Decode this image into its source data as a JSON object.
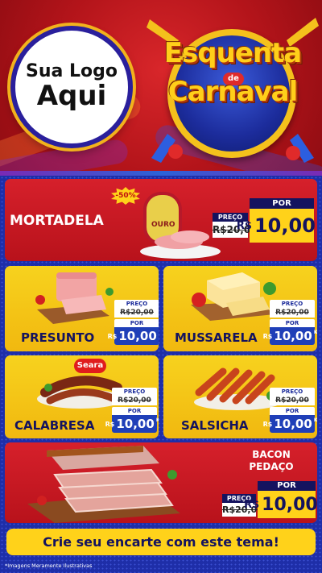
{
  "header": {
    "logo_line1": "Sua Logo",
    "logo_line2": "Aqui",
    "badge_line1": "Esquenta",
    "badge_de": "de",
    "badge_line2": "Carnaval"
  },
  "featured": [
    {
      "name": "MORTADELA",
      "discount": "-50%",
      "brand": "OURO",
      "preco_label": "PREÇO",
      "old_price": "R$20,00",
      "por_label": "POR",
      "currency": "R$",
      "new_price": "10,00",
      "unit": "KG"
    },
    {
      "name": "BACON\nPEDAÇO",
      "name_line1": "BACON",
      "name_line2": "PEDAÇO",
      "preco_label": "PREÇO",
      "old_price": "R$20,00",
      "por_label": "POR",
      "currency": "R$",
      "new_price": "10,00",
      "unit": "KG"
    }
  ],
  "products": [
    {
      "name": "PRESUNTO",
      "preco_label": "PREÇO",
      "old_price": "R$20,00",
      "por_label": "POR",
      "currency": "R$",
      "new_price": "10,00",
      "unit": "KG"
    },
    {
      "name": "MUSSARELA",
      "preco_label": "PREÇO",
      "old_price": "R$20,00",
      "por_label": "POR",
      "currency": "R$",
      "new_price": "10,00",
      "unit": "KG"
    },
    {
      "name": "CALABRESA",
      "brand": "Seara",
      "preco_label": "PREÇO",
      "old_price": "R$20,00",
      "por_label": "POR",
      "currency": "R$",
      "new_price": "10,00",
      "unit": "KG"
    },
    {
      "name": "SALSICHA",
      "preco_label": "PREÇO",
      "old_price": "R$20,00",
      "por_label": "POR",
      "currency": "R$",
      "new_price": "10,00",
      "unit": "KG"
    }
  ],
  "cta": "Crie seu encarte com este tema!",
  "footnote": "*Imagens Meramente Ilustrativas",
  "colors": {
    "red": "#c8161f",
    "yellow": "#f7d21e",
    "navy": "#14135f",
    "blue": "#1f3fb8"
  }
}
